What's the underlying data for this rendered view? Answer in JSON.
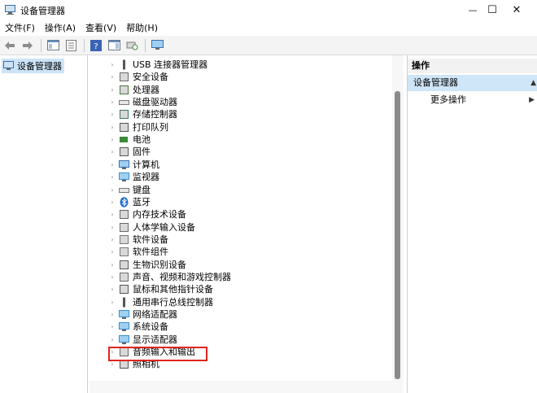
{
  "window": {
    "title": "设备管理器",
    "minimize": "—",
    "maximize": "☐",
    "close": "✕"
  },
  "menu": [
    "文件(F)",
    "操作(A)",
    "查看(V)",
    "帮助(H)"
  ],
  "left_pane": {
    "root_label": "设备管理器"
  },
  "tree_items": [
    {
      "label": "USB 连接器管理器",
      "icon": "usb-connector-icon"
    },
    {
      "label": "安全设备",
      "icon": "security-device-icon"
    },
    {
      "label": "处理器",
      "icon": "processor-icon"
    },
    {
      "label": "磁盘驱动器",
      "icon": "disk-drive-icon"
    },
    {
      "label": "存储控制器",
      "icon": "storage-controller-icon"
    },
    {
      "label": "打印队列",
      "icon": "printer-icon"
    },
    {
      "label": "电池",
      "icon": "battery-icon"
    },
    {
      "label": "固件",
      "icon": "firmware-icon"
    },
    {
      "label": "计算机",
      "icon": "computer-icon"
    },
    {
      "label": "监视器",
      "icon": "monitor-icon"
    },
    {
      "label": "键盘",
      "icon": "keyboard-icon"
    },
    {
      "label": "蓝牙",
      "icon": "bluetooth-icon"
    },
    {
      "label": "内存技术设备",
      "icon": "memory-device-icon"
    },
    {
      "label": "人体学输入设备",
      "icon": "hid-icon"
    },
    {
      "label": "软件设备",
      "icon": "software-device-icon"
    },
    {
      "label": "软件组件",
      "icon": "software-component-icon"
    },
    {
      "label": "生物识别设备",
      "icon": "biometric-icon"
    },
    {
      "label": "声音、视频和游戏控制器",
      "icon": "sound-icon"
    },
    {
      "label": "鼠标和其他指针设备",
      "icon": "mouse-icon"
    },
    {
      "label": "通用串行总线控制器",
      "icon": "usb-controller-icon"
    },
    {
      "label": "网络适配器",
      "icon": "network-adapter-icon"
    },
    {
      "label": "系统设备",
      "icon": "system-device-icon"
    },
    {
      "label": "显示适配器",
      "icon": "display-adapter-icon"
    },
    {
      "label": "音频输入和输出",
      "icon": "audio-io-icon"
    },
    {
      "label": "照相机",
      "icon": "camera-icon"
    }
  ],
  "actions_pane": {
    "header": "操作",
    "section": "设备管理器",
    "more_actions": "更多操作"
  }
}
